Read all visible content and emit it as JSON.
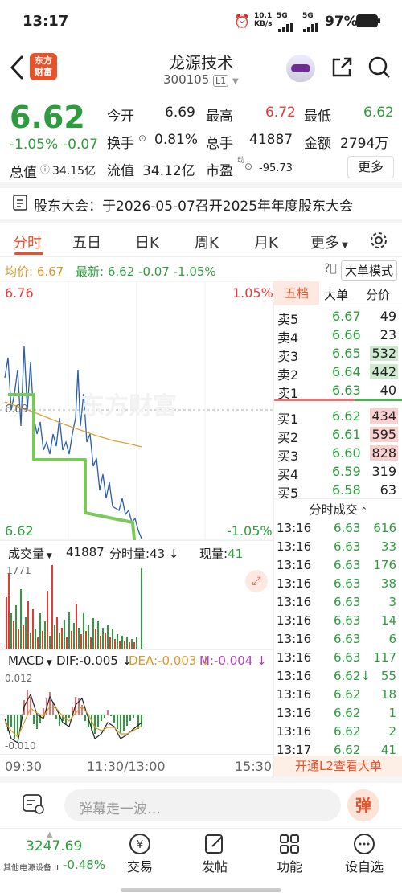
{
  "status": {
    "time": "13:17",
    "speed_top": "10.1",
    "speed_unit": "KB/s",
    "net1": "5G",
    "net2": "5G",
    "battery": "97%"
  },
  "header": {
    "title": "龙源技术",
    "code": "300105",
    "code_badge": "L1",
    "logo_line1": "东方",
    "logo_line2": "财富"
  },
  "quote": {
    "price": "6.62",
    "change_pct": "-1.05%",
    "change": "-0.07",
    "open_label": "今开",
    "open": "6.69",
    "high_label": "最高",
    "high": "6.72",
    "low_label": "最低",
    "low": "6.62",
    "turnover_label": "换手",
    "turnover": "0.81%",
    "volume_label": "总手",
    "volume": "41887",
    "amount_label": "金额",
    "amount": "2794万",
    "mktcap_label": "总值",
    "mktcap": "34.15亿",
    "float_label": "流值",
    "float": "34.12亿",
    "pe_label": "市盈",
    "pe_sup": "动",
    "pe": "-95.73",
    "more": "更多"
  },
  "notice": {
    "text": "股东大会：于2026-05-07召开2025年年度股东大会"
  },
  "tabs": [
    {
      "label": "分时"
    },
    {
      "label": "五日"
    },
    {
      "label": "日K"
    },
    {
      "label": "周K"
    },
    {
      "label": "月K"
    },
    {
      "label": "更多"
    }
  ],
  "chart_info": {
    "avg_label": "均价:",
    "avg": "6.67",
    "latest_label": "最新:",
    "latest": "6.62",
    "chg": "-0.07",
    "chg_pct": "-1.05%",
    "big_order": "大单模式"
  },
  "main_chart": {
    "top_price": "6.76",
    "top_pct": "1.05%",
    "bottom_price": "6.62",
    "bottom_pct": "-1.05%",
    "mid_price": "6.69",
    "watermark": "东方财富"
  },
  "volume_panel": {
    "label": "成交量",
    "total": "41887",
    "fenshi_label": "分时量:",
    "fenshi": "43",
    "now_label": "现量:",
    "now": "41",
    "max": "1771"
  },
  "macd": {
    "label": "MACD",
    "dif": "DIF:-0.005",
    "dea": "DEA:-0.003",
    "m": "M:-0.004",
    "top": "0.012",
    "bottom": "-0.010"
  },
  "time_axis": {
    "start": "09:30",
    "mid": "11:30/13:00",
    "end": "15:30"
  },
  "order_book": {
    "tabs": [
      "五档",
      "大单",
      "分价"
    ],
    "sells": [
      {
        "label": "卖5",
        "price": "6.67",
        "vol": "49"
      },
      {
        "label": "卖4",
        "price": "6.66",
        "vol": "23"
      },
      {
        "label": "卖3",
        "price": "6.65",
        "vol": "532"
      },
      {
        "label": "卖2",
        "price": "6.64",
        "vol": "442"
      },
      {
        "label": "卖1",
        "price": "6.63",
        "vol": "40"
      }
    ],
    "buys": [
      {
        "label": "买1",
        "price": "6.62",
        "vol": "434"
      },
      {
        "label": "买2",
        "price": "6.61",
        "vol": "595"
      },
      {
        "label": "买3",
        "price": "6.60",
        "vol": "828"
      },
      {
        "label": "买4",
        "price": "6.59",
        "vol": "319"
      },
      {
        "label": "买5",
        "price": "6.58",
        "vol": "63"
      }
    ],
    "trades_title": "分时成交",
    "trades": [
      {
        "t": "13:16",
        "p": "6.63",
        "v": "616"
      },
      {
        "t": "13:16",
        "p": "6.63",
        "v": "33"
      },
      {
        "t": "13:16",
        "p": "6.63",
        "v": "176"
      },
      {
        "t": "13:16",
        "p": "6.63",
        "v": "38"
      },
      {
        "t": "13:16",
        "p": "6.63",
        "v": "3"
      },
      {
        "t": "13:16",
        "p": "6.63",
        "v": "14"
      },
      {
        "t": "13:16",
        "p": "6.63",
        "v": "6"
      },
      {
        "t": "13:16",
        "p": "6.63",
        "v": "117"
      },
      {
        "t": "13:16",
        "p": "6.62↓",
        "v": "55"
      },
      {
        "t": "13:16",
        "p": "6.62",
        "v": "18"
      },
      {
        "t": "13:16",
        "p": "6.62",
        "v": "1"
      },
      {
        "t": "13:16",
        "p": "6.62",
        "v": "2"
      },
      {
        "t": "13:17",
        "p": "6.62",
        "v": "41"
      }
    ],
    "l2": "开通L2查看大单"
  },
  "danmu": {
    "placeholder": "弹幕走一波…",
    "btn": "弹"
  },
  "bottom_nav": {
    "index_value": "3247.69",
    "index_name": "其他电源设备 II",
    "index_chg": "-0.48%",
    "items": [
      "交易",
      "发帖",
      "功能",
      "设自选"
    ]
  },
  "colors": {
    "up": "#e53935",
    "down": "#2e9c3e",
    "accent": "#e5532d"
  }
}
